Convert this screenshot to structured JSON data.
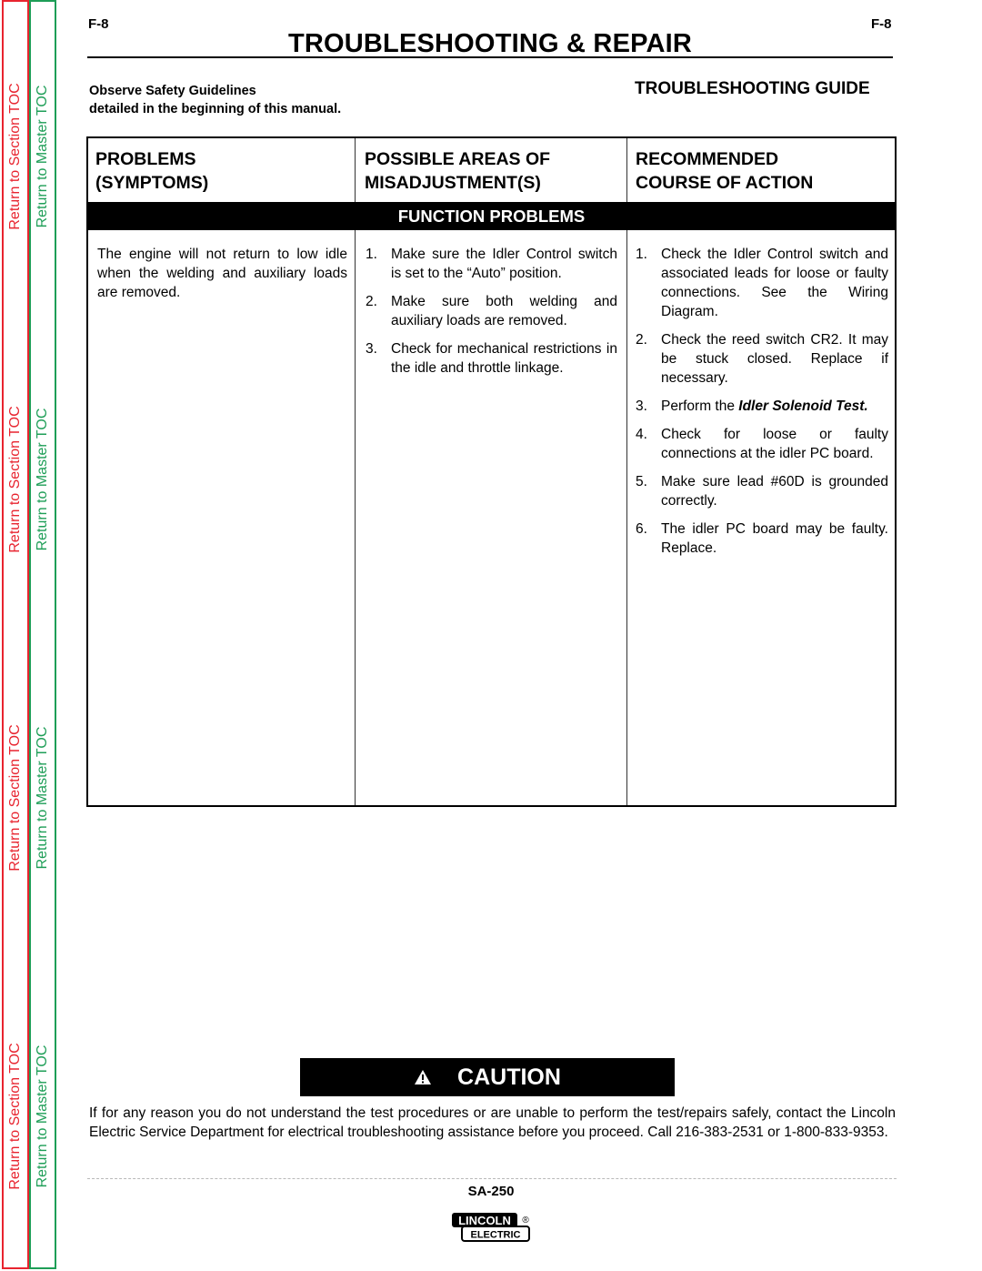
{
  "sidebar": {
    "section_toc_label": "Return to Section TOC",
    "master_toc_label": "Return to Master TOC",
    "colors": {
      "section": "#e8242f",
      "master": "#1e9e57"
    }
  },
  "header": {
    "page_number_left": "F-8",
    "page_number_right": "F-8",
    "title": "TROUBLESHOOTING & REPAIR",
    "safety_line1": "Observe Safety Guidelines",
    "safety_line2": "detailed in the beginning of this manual.",
    "guide_title": "TROUBLESHOOTING GUIDE"
  },
  "table": {
    "headers": [
      {
        "line1": "PROBLEMS",
        "line2": "(SYMPTOMS)"
      },
      {
        "line1": "POSSIBLE AREAS OF",
        "line2": "MISADJUSTMENT(S)"
      },
      {
        "line1": "RECOMMENDED",
        "line2": "COURSE OF ACTION"
      }
    ],
    "section_band": "FUNCTION PROBLEMS",
    "rows": [
      {
        "symptom": "The engine will not return to low idle when the welding and auxiliary loads are removed.",
        "misadjustments": [
          {
            "num": "1.",
            "text": "Make sure the Idler Control switch is set to the “Auto” position."
          },
          {
            "num": "2.",
            "text": "Make sure both welding and auxiliary loads are removed."
          },
          {
            "num": "3.",
            "text": "Check for mechanical restrictions in the idle and throttle linkage."
          }
        ],
        "actions": [
          {
            "num": "1.",
            "text": "Check the Idler Control switch and associated leads for loose or faulty connections.  See the Wiring Diagram."
          },
          {
            "num": "2.",
            "text": "Check the reed switch CR2.  It may be stuck closed.  Replace if necessary."
          },
          {
            "num": "3.",
            "text": "Perform the ",
            "emphasis": "Idler Solenoid Test."
          },
          {
            "num": "4.",
            "text": "Check for loose or faulty connections at the idler PC board."
          },
          {
            "num": "5.",
            "text": "Make sure lead #60D is grounded correctly."
          },
          {
            "num": "6.",
            "text": "The idler PC board may be faulty.  Replace."
          }
        ]
      }
    ]
  },
  "caution": {
    "icon": "warning-triangle-icon",
    "label": "CAUTION",
    "text": "If for any reason you do not understand the test procedures or are unable to perform the test/repairs safely, contact the Lincoln Electric Service Department for electrical troubleshooting assistance before you proceed.  Call 216-383-2531 or 1-800-833-9353."
  },
  "footer": {
    "model": "SA-250",
    "logo_top": "LINCOLN",
    "logo_bottom": "ELECTRIC",
    "logo_mark": "®"
  }
}
